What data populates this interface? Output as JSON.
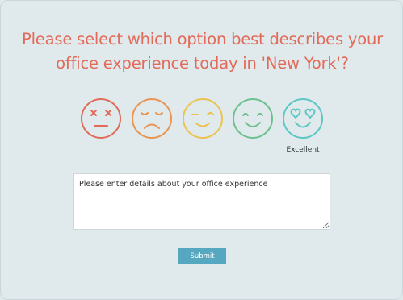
{
  "question": {
    "line1": "Please select which option best describes your",
    "line2": "office experience today in 'New York'?"
  },
  "faces": [
    {
      "name": "very-unhappy-face-icon",
      "color": "#df6b58",
      "label": ""
    },
    {
      "name": "unhappy-face-icon",
      "color": "#e9944f",
      "label": ""
    },
    {
      "name": "neutral-face-icon",
      "color": "#ecc24e",
      "label": ""
    },
    {
      "name": "happy-face-icon",
      "color": "#6cc08b",
      "label": ""
    },
    {
      "name": "love-face-icon",
      "color": "#5cc7c4",
      "label": "Excellent"
    }
  ],
  "details": {
    "placeholder": "Please enter details about your office experience"
  },
  "submit": {
    "label": "Submit",
    "color": "#56a7c0"
  }
}
